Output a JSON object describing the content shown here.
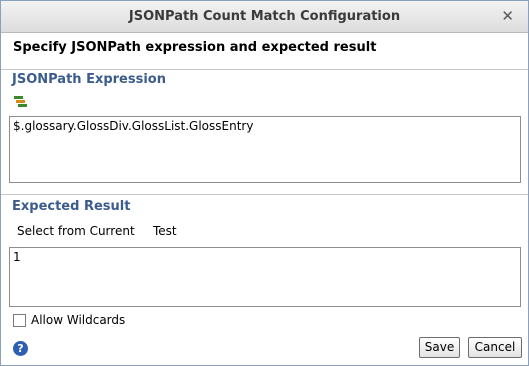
{
  "window": {
    "title": "JSONPath Count Match Configuration",
    "close_glyph": "✕"
  },
  "header": {
    "text": "Specify JSONPath expression and expected result"
  },
  "expression": {
    "label": "JSONPath Expression",
    "tree_icon": "tree-icon",
    "value": "$.glossary.GlossDiv.GlossList.GlossEntry"
  },
  "expected": {
    "label": "Expected Result",
    "select_from_current": "Select from Current",
    "test": "Test",
    "value": "1"
  },
  "options": {
    "allow_wildcards_label": "Allow Wildcards",
    "allow_wildcards_checked": false
  },
  "footer": {
    "help_glyph": "?",
    "save_label": "Save",
    "cancel_label": "Cancel"
  },
  "colors": {
    "section_label": "#3c5c8c",
    "help_icon": "#2f5fb3"
  }
}
